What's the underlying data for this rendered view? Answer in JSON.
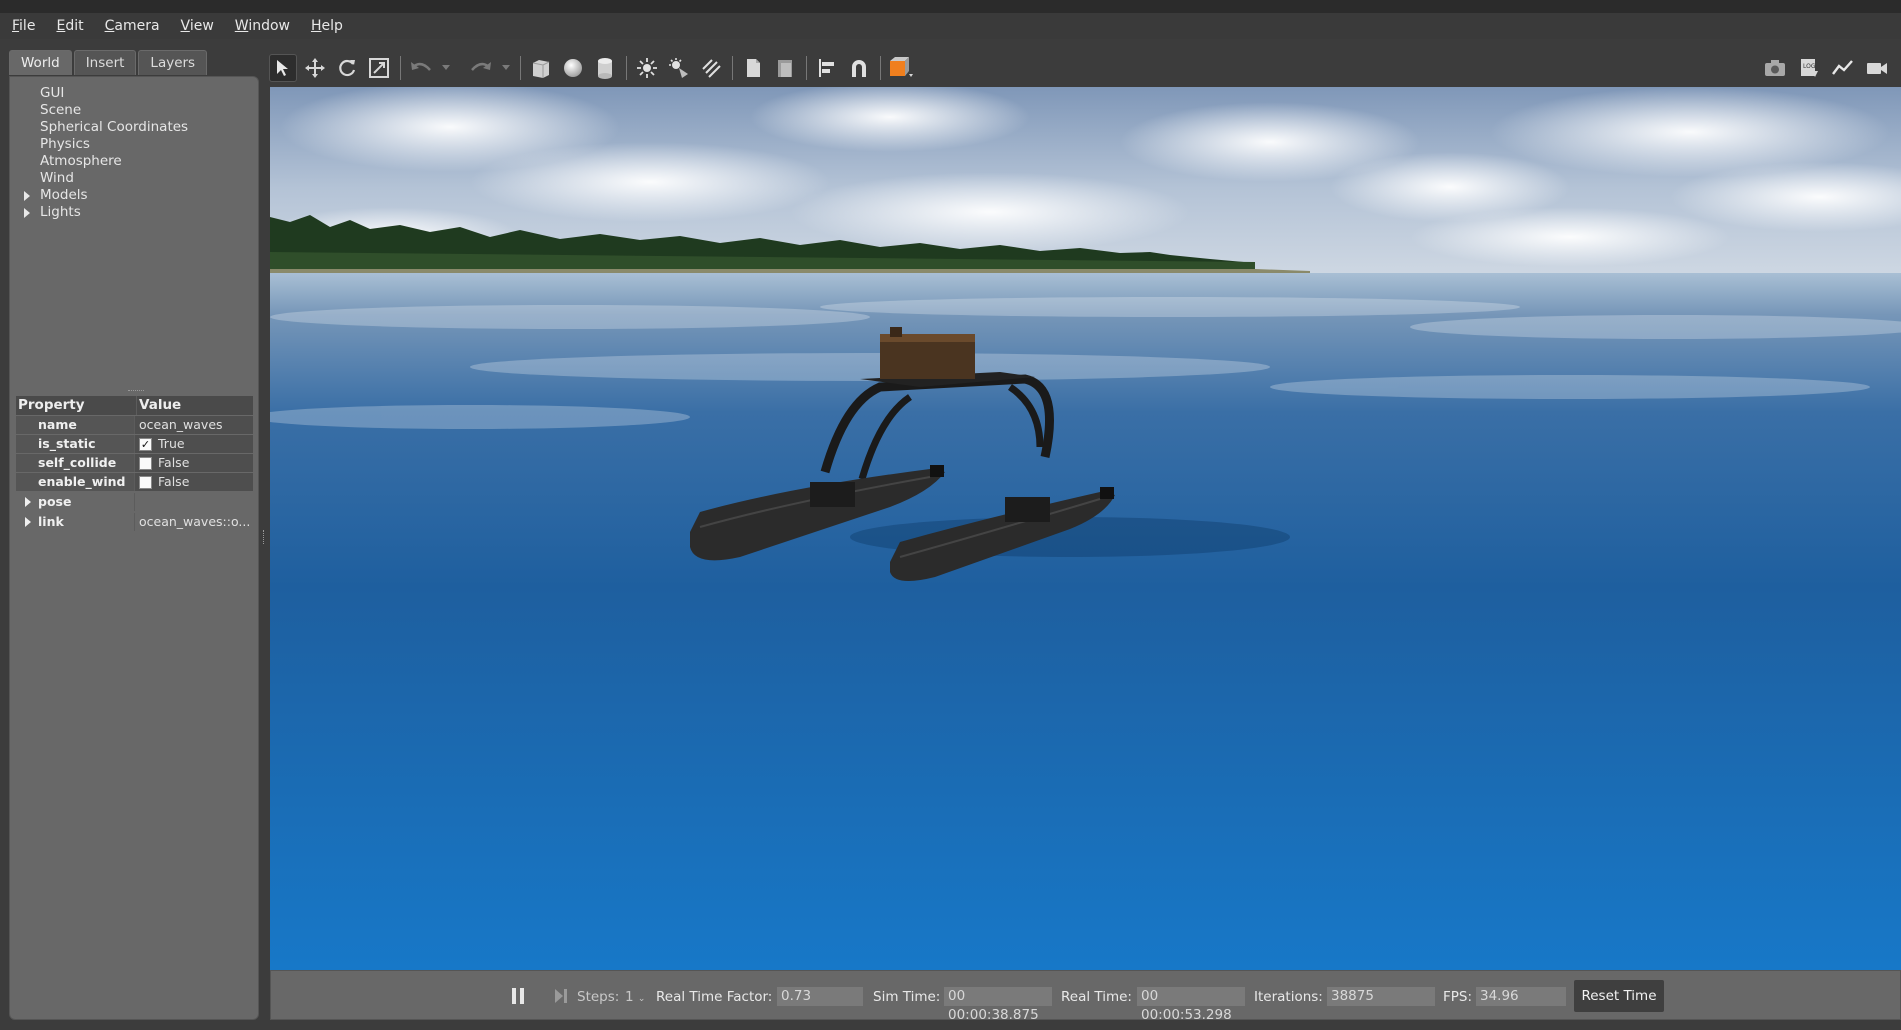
{
  "menu": [
    {
      "label": "File",
      "mnemonic": "F",
      "rest": "ile"
    },
    {
      "label": "Edit",
      "mnemonic": "E",
      "rest": "dit"
    },
    {
      "label": "Camera",
      "mnemonic": "C",
      "rest": "amera"
    },
    {
      "label": "View",
      "mnemonic": "V",
      "rest": "iew"
    },
    {
      "label": "Window",
      "mnemonic": "W",
      "rest": "indow"
    },
    {
      "label": "Help",
      "mnemonic": "H",
      "rest": "elp"
    }
  ],
  "left_panel": {
    "tabs": [
      "World",
      "Insert",
      "Layers"
    ],
    "active_tab": "World",
    "tree": [
      "GUI",
      "Scene",
      "Spherical Coordinates",
      "Physics",
      "Atmosphere",
      "Wind",
      "Models",
      "Lights"
    ],
    "property_header": {
      "name": "Property",
      "value": "Value"
    },
    "properties": [
      {
        "name": "name",
        "value": "ocean_waves"
      },
      {
        "name": "is_static",
        "value": "True",
        "checked": true
      },
      {
        "name": "self_collide",
        "value": "False",
        "checked": false
      },
      {
        "name": "enable_wind",
        "value": "False",
        "checked": false
      },
      {
        "name": "pose",
        "value": ""
      },
      {
        "name": "link",
        "value": "ocean_waves::o..."
      }
    ]
  },
  "toolbar": {
    "left_icons": [
      "select-arrow-icon",
      "translate-icon",
      "rotate-icon",
      "scale-icon",
      "undo-icon",
      "undo-dropdown-icon",
      "redo-icon",
      "redo-dropdown-icon",
      "box-shape-icon",
      "sphere-shape-icon",
      "cylinder-shape-icon",
      "point-light-icon",
      "spot-light-icon",
      "directional-light-icon",
      "copy-icon",
      "paste-icon",
      "align-icon",
      "snap-icon",
      "view-angle-icon"
    ],
    "right_icons": [
      "screenshot-icon",
      "log-icon",
      "plot-icon",
      "record-video-icon"
    ]
  },
  "bottom_bar": {
    "steps_label": "Steps:",
    "steps_value": "1",
    "rtf_label": "Real Time Factor:",
    "rtf_value": "0.73",
    "sim_time_label": "Sim Time:",
    "sim_time_value": "00 00:00:38.875",
    "real_time_label": "Real Time:",
    "real_time_value": "00 00:00:53.298",
    "iterations_label": "Iterations:",
    "iterations_value": "38875",
    "fps_label": "FPS:",
    "fps_value": "34.96",
    "reset_label": "Reset Time"
  },
  "colors": {
    "sky": "#b9c8dc",
    "water": "#1f6fb8",
    "accent_orange": "#f07f1e"
  }
}
